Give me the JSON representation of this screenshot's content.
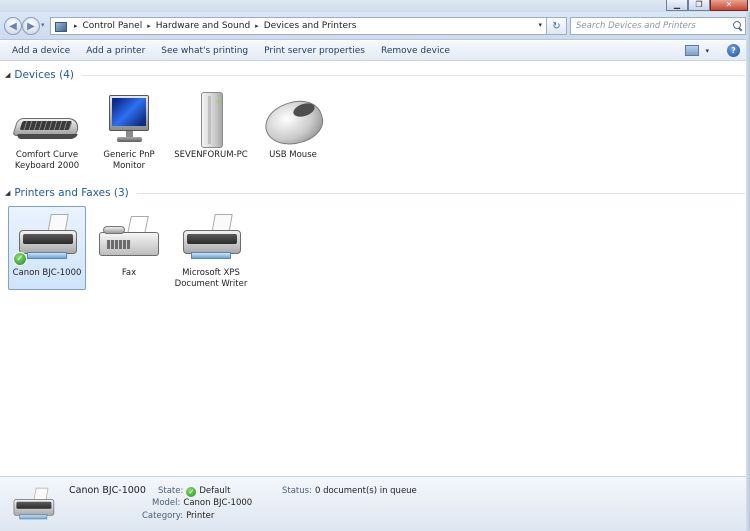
{
  "window": {
    "minimize_glyph": "▁",
    "maximize_glyph": "❐",
    "close_glyph": "✕"
  },
  "address": {
    "back_glyph": "◀",
    "forward_glyph": "▶",
    "dropdown_glyph": "▾",
    "breadcrumbs": [
      "Control Panel",
      "Hardware and Sound",
      "Devices and Printers"
    ],
    "separator": "▸",
    "refresh_glyph": "↻"
  },
  "search": {
    "placeholder": "Search Devices and Printers"
  },
  "toolbar": {
    "buttons": [
      "Add a device",
      "Add a printer",
      "See what's printing",
      "Print server properties",
      "Remove device"
    ],
    "view_dropdown_glyph": "▾",
    "help_glyph": "?"
  },
  "groups": {
    "devices": {
      "arrow": "◢",
      "title": "Devices (4)",
      "items": [
        {
          "label": "Comfort Curve Keyboard 2000",
          "icon": "keyboard-icon"
        },
        {
          "label": "Generic PnP Monitor",
          "icon": "monitor-icon"
        },
        {
          "label": "SEVENFORUM-PC",
          "icon": "computer-tower-icon"
        },
        {
          "label": "USB Mouse",
          "icon": "mouse-icon"
        }
      ]
    },
    "printers": {
      "arrow": "◢",
      "title": "Printers and Faxes (3)",
      "items": [
        {
          "label": "Canon BJC-1000",
          "icon": "printer-icon",
          "selected": true,
          "default": true
        },
        {
          "label": "Fax",
          "icon": "fax-icon"
        },
        {
          "label": "Microsoft XPS Document Writer",
          "icon": "printer-icon"
        }
      ]
    }
  },
  "details": {
    "name": "Canon BJC-1000",
    "state_label": "State:",
    "state_value": "Default",
    "model_label": "Model:",
    "model_value": "Canon BJC-1000",
    "category_label": "Category:",
    "category_value": "Printer",
    "status_label": "Status:",
    "status_value": "0 document(s) in queue",
    "check_glyph": "✓"
  },
  "colors": {
    "group_title": "#1e5a9a",
    "selection": "#cfe4fb",
    "default_check": "#1f8b1b"
  }
}
